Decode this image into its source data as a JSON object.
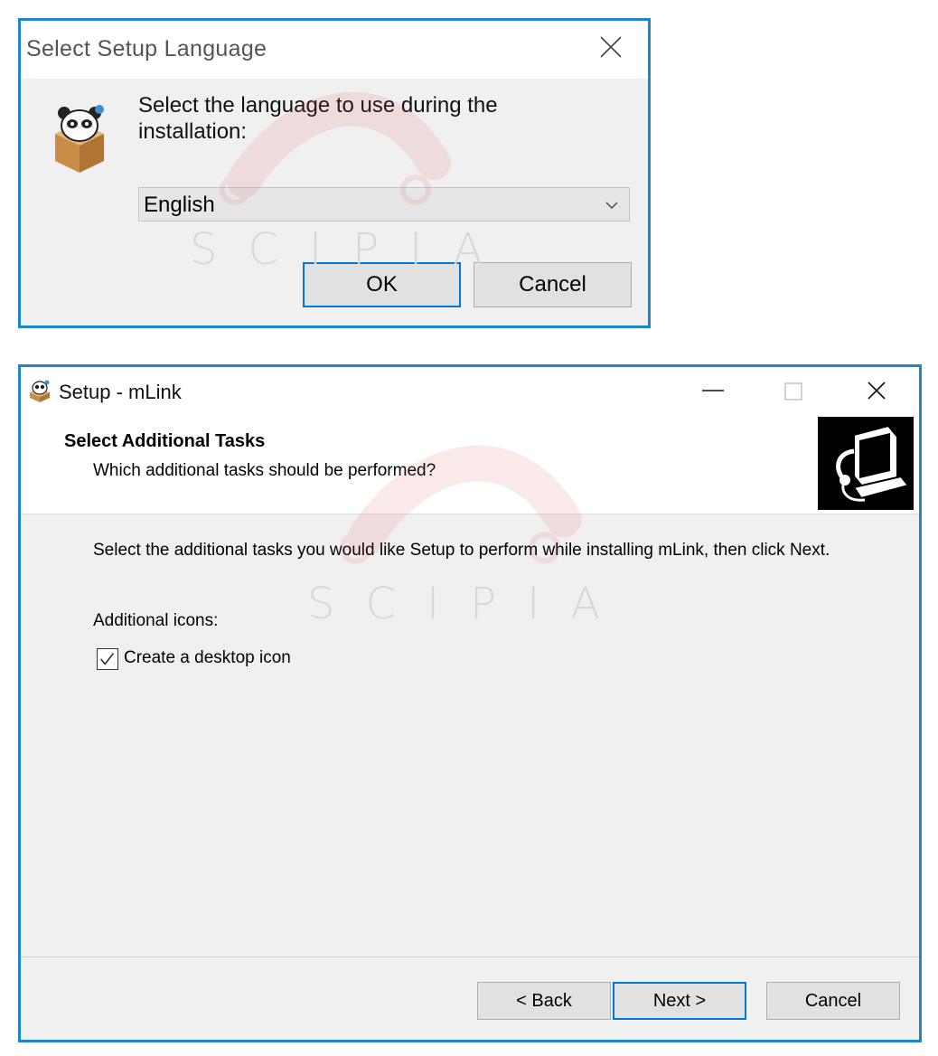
{
  "language_dialog": {
    "title": "Select Setup Language",
    "prompt": "Select the language to use during the installation:",
    "selected_language": "English",
    "ok_label": "OK",
    "cancel_label": "Cancel",
    "icons": {
      "close": "close-icon",
      "app": "setup-panda-box-icon",
      "dropdown": "chevron-down-icon"
    }
  },
  "setup_wizard": {
    "window_title": "Setup - mLink",
    "header_title": "Select Additional Tasks",
    "header_subtitle": "Which additional tasks should be performed?",
    "description": "Select the additional tasks you would like Setup to perform while installing mLink, then click Next.",
    "section_label": "Additional icons:",
    "tasks": [
      {
        "label": "Create a desktop icon",
        "checked": true
      }
    ],
    "back_label": "< Back",
    "next_label": "Next >",
    "cancel_label": "Cancel",
    "icons": {
      "window": "setup-panda-box-icon",
      "minimize": "minimize-icon",
      "maximize": "maximize-icon",
      "close": "close-icon",
      "header": "computer-install-icon"
    }
  },
  "watermark": {
    "text": "SCIPIA"
  },
  "colors": {
    "accent_border": "#1c86d1",
    "default_button_border": "#0078d7",
    "dialog_bg": "#f0f0f0",
    "watermark": "#e9a3a3"
  }
}
